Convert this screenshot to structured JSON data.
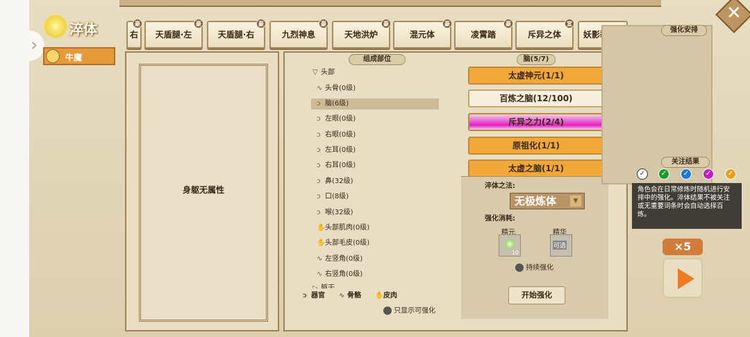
{
  "header": {
    "title": "淬体",
    "character": "牛魔"
  },
  "tabs": [
    {
      "label": "右",
      "badge": "豪"
    },
    {
      "label": "天盾腿·左",
      "badge": "豪"
    },
    {
      "label": "天盾腿·右",
      "badge": "豪"
    },
    {
      "label": "九烈神息",
      "badge": "豪"
    },
    {
      "label": "天地洪炉",
      "badge": "豪"
    },
    {
      "label": "混元体",
      "badge": "豪"
    },
    {
      "label": "凌霄踏",
      "badge": "豪"
    },
    {
      "label": "斥异之体",
      "badge": "宣"
    },
    {
      "label": "妖影裂风尾",
      "badge": ""
    }
  ],
  "body_panel": {
    "text": "身躯无属性"
  },
  "parts_panel": {
    "header": "组成部位",
    "group": "头部",
    "items": [
      "头骨(0级)",
      "脑(6级)",
      "左眼(0级)",
      "右眼(0级)",
      "左耳(0级)",
      "右耳(0级)",
      "鼻(32级)",
      "口(8级)",
      "喉(32级)",
      "头部肌肉(0级)",
      "头部毛皮(0级)",
      "左竖角(0级)",
      "右竖角(0级)"
    ],
    "next_group": "躯干",
    "filters": [
      "器官",
      "骨骼",
      "皮肉"
    ],
    "only_show": "只显示可强化"
  },
  "brain_panel": {
    "header": "脑(5/7)",
    "options": [
      "太虚神元(1/1)",
      "百炼之脑(12/100)",
      "斥异之力(2/4)",
      "原祖化(1/1)",
      "太虚之脑(1/1)"
    ],
    "method_label": "淬体之法:",
    "method_value": "无极炼体",
    "cost_label": "强化消耗:",
    "cost_items": [
      {
        "name": "精元",
        "amount": "10"
      },
      {
        "name": "精华",
        "status": "可选"
      }
    ],
    "continuous": "持续强化",
    "start": "开始强化"
  },
  "right_panel": {
    "title": "强化安排",
    "focus": "关注结果",
    "info": "角色会在日常修炼时随机进行安排中的强化。淬体结果不被关注或无重要词条时会自动选择百炼。",
    "multiplier": "×5"
  },
  "colors": {
    "accent": "#f0a030",
    "pink": "#e020c0",
    "check_colors": [
      "#ffffff",
      "#1e9a2a",
      "#1e78d8",
      "#c020c0",
      "#e8a020"
    ]
  }
}
